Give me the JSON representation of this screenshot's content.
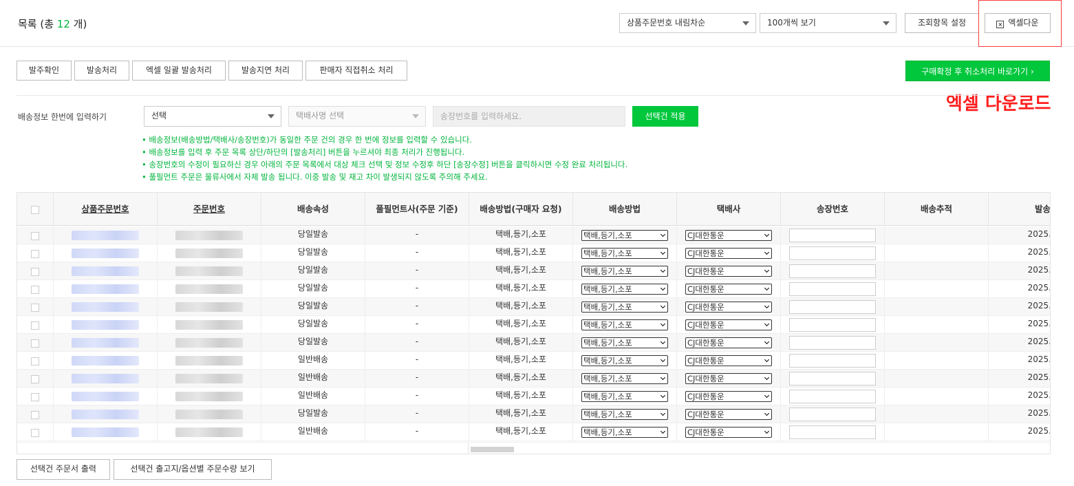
{
  "header": {
    "title_prefix": "목록 (총 ",
    "total_count": "12",
    "title_suffix": " 개)",
    "sort_select": "상품주문번호 내림차순",
    "page_size_select": "100개씩 보기",
    "column_settings_label": "조회항목 설정",
    "excel_download_label": "엑셀다운"
  },
  "annotation": "엑셀 다운로드",
  "actions": [
    "발주확인",
    "발송처리",
    "엑셀 일괄 발송처리",
    "발송지연 처리",
    "판매자 직접취소 처리"
  ],
  "purchase_confirm_cancel_label": "구매확정 후 취소처리 바로가기 ›",
  "bulk_shipping": {
    "label": "배송정보 한번에 입력하기",
    "method_select": "선택",
    "courier_select": "택배사명 선택",
    "tracking_placeholder": "송장번호를 입력하세요.",
    "apply_label": "선택건 적용"
  },
  "notes": [
    "• 배송정보(배송방법/택배사/송장번호)가 동일한 주문 건의 경우 한 번에 정보를 입력할 수 있습니다.",
    "• 배송정보를 입력 후 주문 목록 상단/하단의 [발송처리] 버튼을 누르셔야 최종 처리가 진행됩니다.",
    "• 송장번호의 수정이 필요하신 경우 아래의 주문 목록에서 대상 체크 선택 및 정보 수정후 하단 [송장수정] 버튼을 클릭하시면 수정 완료 처리됩니다.",
    "• 풀필먼트 주문은 물류사에서 자체 발송 됩니다. 이중 발송 및 재고 차이 발생되지 않도록 주의해 주세요."
  ],
  "table": {
    "columns": [
      "상품주문번호",
      "주문번호",
      "배송속성",
      "풀필먼트사(주문 기준)",
      "배송방법(구매자 요청)",
      "배송방법",
      "택배사",
      "송장번호",
      "배송추적",
      "발송"
    ],
    "rows": [
      {
        "attr": "당일발송",
        "fulfillment": "-",
        "req_method": "택배,등기,소포",
        "method": "택배,등기,소포",
        "courier": "CJ대한통운",
        "date": "2025."
      },
      {
        "attr": "당일발송",
        "fulfillment": "-",
        "req_method": "택배,등기,소포",
        "method": "택배,등기,소포",
        "courier": "CJ대한통운",
        "date": "2025."
      },
      {
        "attr": "당일발송",
        "fulfillment": "-",
        "req_method": "택배,등기,소포",
        "method": "택배,등기,소포",
        "courier": "CJ대한통운",
        "date": "2025."
      },
      {
        "attr": "당일발송",
        "fulfillment": "-",
        "req_method": "택배,등기,소포",
        "method": "택배,등기,소포",
        "courier": "CJ대한통운",
        "date": "2025."
      },
      {
        "attr": "당일발송",
        "fulfillment": "-",
        "req_method": "택배,등기,소포",
        "method": "택배,등기,소포",
        "courier": "CJ대한통운",
        "date": "2025."
      },
      {
        "attr": "당일발송",
        "fulfillment": "-",
        "req_method": "택배,등기,소포",
        "method": "택배,등기,소포",
        "courier": "CJ대한통운",
        "date": "2025."
      },
      {
        "attr": "당일발송",
        "fulfillment": "-",
        "req_method": "택배,등기,소포",
        "method": "택배,등기,소포",
        "courier": "CJ대한통운",
        "date": "2025."
      },
      {
        "attr": "일반배송",
        "fulfillment": "-",
        "req_method": "택배,등기,소포",
        "method": "택배,등기,소포",
        "courier": "CJ대한통운",
        "date": "2025."
      },
      {
        "attr": "일반배송",
        "fulfillment": "-",
        "req_method": "택배,등기,소포",
        "method": "택배,등기,소포",
        "courier": "CJ대한통운",
        "date": "2025."
      },
      {
        "attr": "일반배송",
        "fulfillment": "-",
        "req_method": "택배,등기,소포",
        "method": "택배,등기,소포",
        "courier": "CJ대한통운",
        "date": "2025."
      },
      {
        "attr": "당일발송",
        "fulfillment": "-",
        "req_method": "택배,등기,소포",
        "method": "택배,등기,소포",
        "courier": "CJ대한통운",
        "date": "2025."
      },
      {
        "attr": "일반배송",
        "fulfillment": "-",
        "req_method": "택배,등기,소포",
        "method": "택배,등기,소포",
        "courier": "CJ대한통운",
        "date": "2025."
      }
    ]
  },
  "bottom_actions": [
    "선택건 주문서 출력",
    "선택건 출고지/옵션별 주문수량 보기"
  ]
}
